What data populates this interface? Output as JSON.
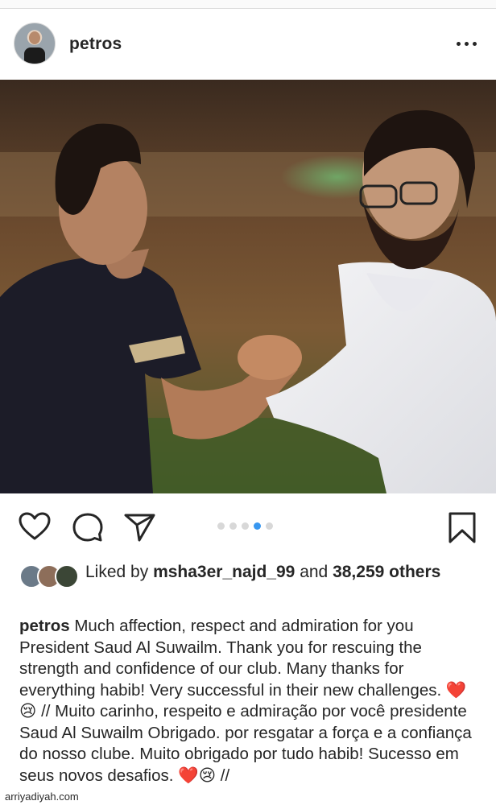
{
  "post": {
    "username": "petros",
    "more_icon": "more-horizontal-icon"
  },
  "actions": {
    "icons": [
      "heart-icon",
      "comment-icon",
      "share-icon",
      "bookmark-icon"
    ],
    "carousel": {
      "count": 5,
      "active_index": 3
    }
  },
  "likes": {
    "prefix": "Liked by",
    "user": "msha3er_najd_99",
    "and_word": "and",
    "count": "38,259",
    "others_word": "others"
  },
  "caption": {
    "username": "petros",
    "part1": "Much affection, respect and admiration for you President Saud Al Suwailm.  Thank you for rescuing the strength and confidence of our club. Many thanks for everything habib! Very successful in their new challenges.",
    "emoji1": "❤️",
    "emoji2": "😢",
    "part2": "// Muito carinho, respeito e admiração por você presidente Saud Al Suwailm Obrigado.  por resgatar a força e a confiança do nosso clube. Muito obrigado por tudo habib! Sucesso em seus novos desafios.",
    "emoji3": "❤️",
    "emoji4": "😢",
    "tail": "//"
  },
  "watermark": "arriyadiyah.com",
  "colors": {
    "heart": "#e8221b",
    "active_dot": "#3897f0",
    "inactive_dot": "#d8d8d8"
  }
}
